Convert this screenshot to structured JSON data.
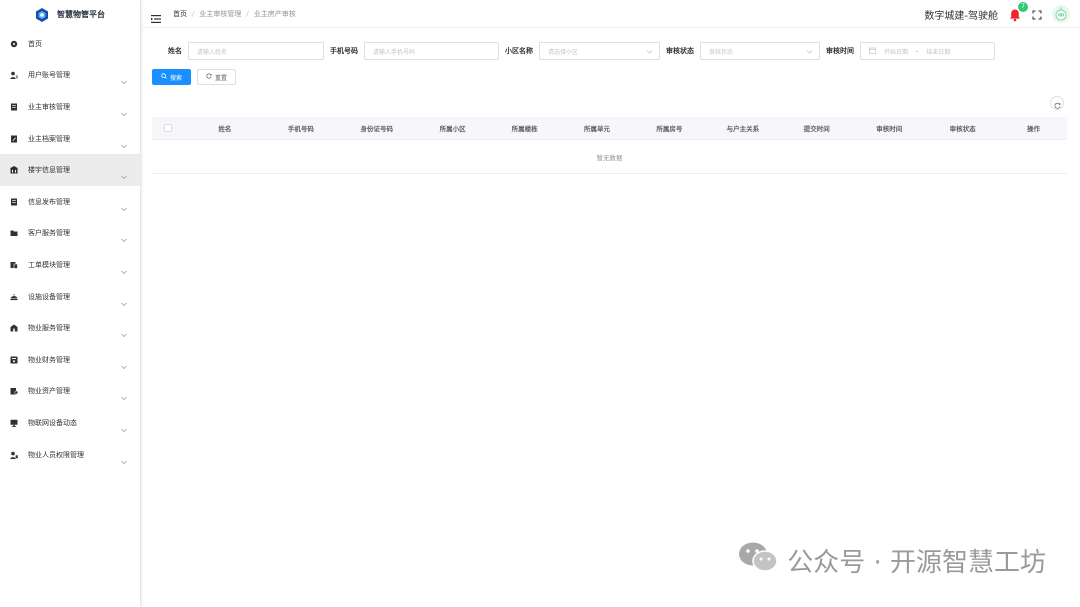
{
  "app": {
    "title": "智慧物管平台"
  },
  "sidebar": {
    "items": [
      {
        "label": "首页",
        "icon": "dashboard-icon",
        "has_children": false
      },
      {
        "label": "用户账号管理",
        "icon": "user-icon",
        "has_children": true
      },
      {
        "label": "业主审核管理",
        "icon": "document-icon",
        "has_children": true
      },
      {
        "label": "业主档案管理",
        "icon": "edit-document-icon",
        "has_children": true
      },
      {
        "label": "楼宇信息管理",
        "icon": "building-icon",
        "has_children": true,
        "active": true
      },
      {
        "label": "信息发布管理",
        "icon": "document-icon",
        "has_children": true
      },
      {
        "label": "客户服务管理",
        "icon": "folder-icon",
        "has_children": true
      },
      {
        "label": "工单模块管理",
        "icon": "ticket-icon",
        "has_children": true
      },
      {
        "label": "设施设备管理",
        "icon": "facility-icon",
        "has_children": true
      },
      {
        "label": "物业服务管理",
        "icon": "service-icon",
        "has_children": true
      },
      {
        "label": "物业财务管理",
        "icon": "finance-icon",
        "has_children": true
      },
      {
        "label": "物业资产管理",
        "icon": "asset-icon",
        "has_children": true
      },
      {
        "label": "物联网设备动态",
        "icon": "monitor-icon",
        "has_children": true
      },
      {
        "label": "物业人员权限管理",
        "icon": "user-permission-icon",
        "has_children": true
      }
    ]
  },
  "header": {
    "breadcrumb": [
      "首页",
      "业主审核管理",
      "业主房产审核"
    ],
    "org_name": "数字城建-驾驶舱",
    "notification_count": "7"
  },
  "filters": {
    "name": {
      "label": "姓名",
      "placeholder": "请输入姓名"
    },
    "phone": {
      "label": "手机号码",
      "placeholder": "请输入手机号码"
    },
    "community": {
      "label": "小区名称",
      "placeholder": "请选择小区"
    },
    "status": {
      "label": "审核状态",
      "placeholder": "审核状态"
    },
    "time": {
      "label": "审核时间",
      "start_placeholder": "开始日期",
      "separator": "-",
      "end_placeholder": "结束日期"
    }
  },
  "buttons": {
    "search": "搜索",
    "reset": "重置"
  },
  "table": {
    "columns": [
      "姓名",
      "手机号码",
      "身份证号码",
      "所属小区",
      "所属楼栋",
      "所属单元",
      "所属房号",
      "与户主关系",
      "提交时间",
      "审核时间",
      "审核状态",
      "操作"
    ],
    "empty_text": "暂无数据"
  },
  "watermark": "公众号 · 开源智慧工坊",
  "colors": {
    "primary": "#1890ff",
    "badge": "#2ecc71",
    "bell": "#f5222d",
    "active_bg": "#ececec"
  }
}
